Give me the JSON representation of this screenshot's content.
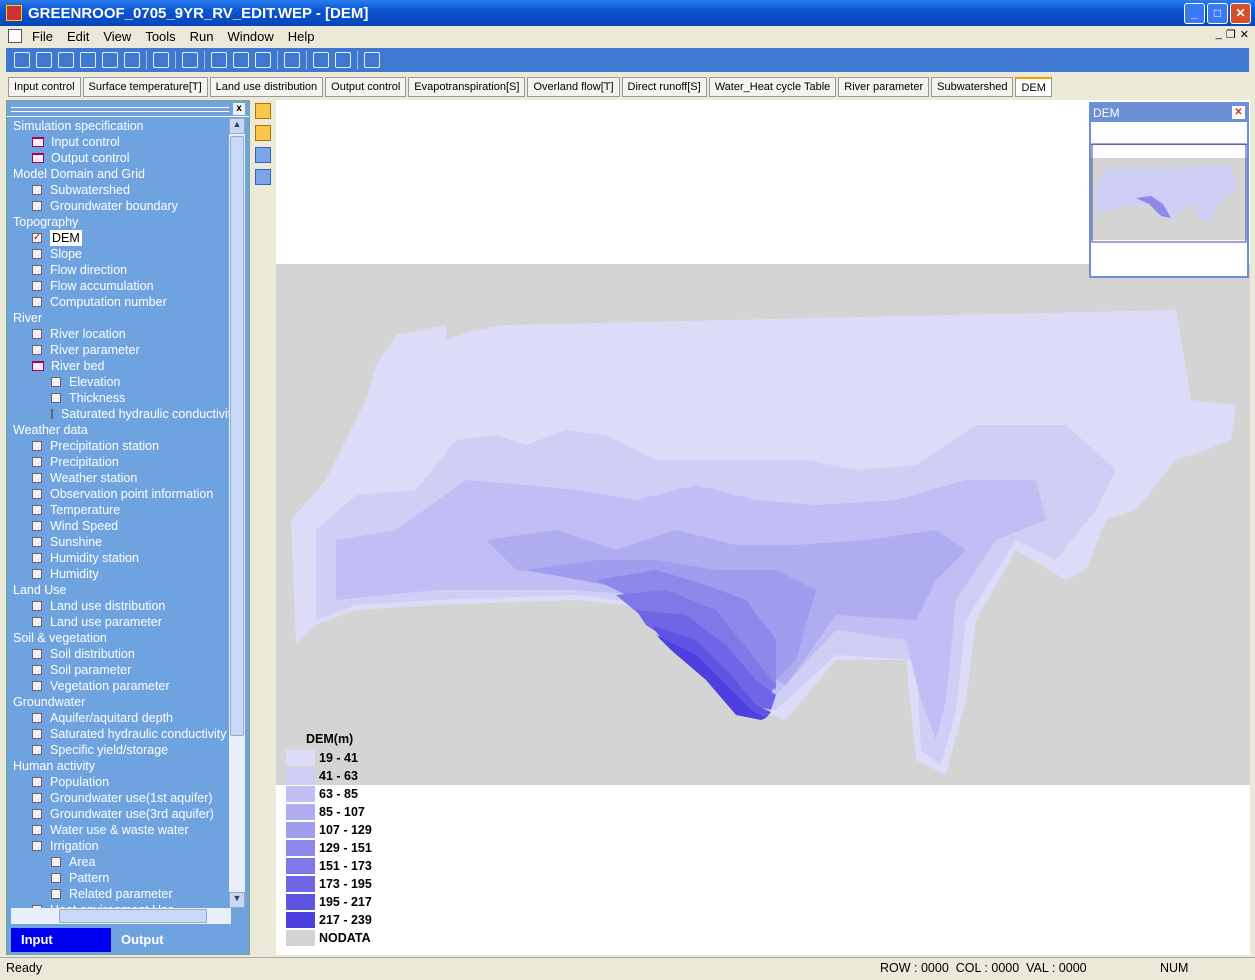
{
  "window": {
    "title": "GREENROOF_0705_9YR_RV_EDIT.WEP - [DEM]"
  },
  "menu": [
    "File",
    "Edit",
    "View",
    "Tools",
    "Run",
    "Window",
    "Help"
  ],
  "tabs": [
    {
      "label": "Input control"
    },
    {
      "label": "Surface temperature[T]"
    },
    {
      "label": "Land use distribution"
    },
    {
      "label": "Output control"
    },
    {
      "label": "Evapotranspiration[S]"
    },
    {
      "label": "Overland flow[T]"
    },
    {
      "label": "Direct runoff[S]"
    },
    {
      "label": "Water_Heat cycle Table"
    },
    {
      "label": "River parameter"
    },
    {
      "label": "Subwatershed"
    },
    {
      "label": "DEM",
      "active": true
    }
  ],
  "tree": [
    {
      "label": "Simulation specification",
      "level": 0,
      "icon": "none"
    },
    {
      "label": "Input control",
      "level": 1,
      "icon": "folder"
    },
    {
      "label": "Output control",
      "level": 1,
      "icon": "folder"
    },
    {
      "label": "Model Domain and Grid",
      "level": 0,
      "icon": "none"
    },
    {
      "label": "Subwatershed",
      "level": 1,
      "icon": "checkbox"
    },
    {
      "label": "Groundwater boundary",
      "level": 1,
      "icon": "checkbox"
    },
    {
      "label": "Topography",
      "level": 0,
      "icon": "none"
    },
    {
      "label": "DEM",
      "level": 1,
      "icon": "checked",
      "selected": true
    },
    {
      "label": "Slope",
      "level": 1,
      "icon": "checkbox"
    },
    {
      "label": "Flow direction",
      "level": 1,
      "icon": "checkbox"
    },
    {
      "label": "Flow accumulation",
      "level": 1,
      "icon": "checkbox"
    },
    {
      "label": "Computation number",
      "level": 1,
      "icon": "checkbox"
    },
    {
      "label": "River",
      "level": 0,
      "icon": "none"
    },
    {
      "label": "River location",
      "level": 1,
      "icon": "checkbox"
    },
    {
      "label": "River parameter",
      "level": 1,
      "icon": "checkbox"
    },
    {
      "label": "River bed",
      "level": 1,
      "icon": "folder"
    },
    {
      "label": "Elevation",
      "level": 2,
      "icon": "checkbox"
    },
    {
      "label": "Thickness",
      "level": 2,
      "icon": "checkbox"
    },
    {
      "label": "Saturated hydraulic conductivity",
      "level": 2,
      "icon": "checkbox"
    },
    {
      "label": "Weather data",
      "level": 0,
      "icon": "none"
    },
    {
      "label": "Precipitation station",
      "level": 1,
      "icon": "checkbox"
    },
    {
      "label": "Precipitation",
      "level": 1,
      "icon": "checkbox"
    },
    {
      "label": "Weather station",
      "level": 1,
      "icon": "checkbox"
    },
    {
      "label": "Observation point information",
      "level": 1,
      "icon": "checkbox"
    },
    {
      "label": "Temperature",
      "level": 1,
      "icon": "checkbox"
    },
    {
      "label": "Wind Speed",
      "level": 1,
      "icon": "checkbox"
    },
    {
      "label": "Sunshine",
      "level": 1,
      "icon": "checkbox"
    },
    {
      "label": "Humidity station",
      "level": 1,
      "icon": "checkbox"
    },
    {
      "label": "Humidity",
      "level": 1,
      "icon": "checkbox"
    },
    {
      "label": "Land Use",
      "level": 0,
      "icon": "none"
    },
    {
      "label": "Land use distribution",
      "level": 1,
      "icon": "checkbox"
    },
    {
      "label": "Land use parameter",
      "level": 1,
      "icon": "checkbox"
    },
    {
      "label": "Soil & vegetation",
      "level": 0,
      "icon": "none"
    },
    {
      "label": "Soil distribution",
      "level": 1,
      "icon": "checkbox"
    },
    {
      "label": "Soil parameter",
      "level": 1,
      "icon": "checkbox"
    },
    {
      "label": "Vegetation parameter",
      "level": 1,
      "icon": "checkbox"
    },
    {
      "label": "Groundwater",
      "level": 0,
      "icon": "none"
    },
    {
      "label": "Aquifer/aquitard depth",
      "level": 1,
      "icon": "checkbox"
    },
    {
      "label": "Saturated hydraulic conductivity",
      "level": 1,
      "icon": "checkbox"
    },
    {
      "label": "Specific yield/storage",
      "level": 1,
      "icon": "checkbox"
    },
    {
      "label": "Human activity",
      "level": 0,
      "icon": "none"
    },
    {
      "label": "Population",
      "level": 1,
      "icon": "checkbox"
    },
    {
      "label": "Groundwater use(1st aquifer)",
      "level": 1,
      "icon": "checkbox"
    },
    {
      "label": "Groundwater use(3rd aquifer)",
      "level": 1,
      "icon": "checkbox"
    },
    {
      "label": "Water use & waste water",
      "level": 1,
      "icon": "checkbox"
    },
    {
      "label": "Irrigation",
      "level": 1,
      "icon": "checkbox"
    },
    {
      "label": "Area",
      "level": 2,
      "icon": "checkbox"
    },
    {
      "label": "Pattern",
      "level": 2,
      "icon": "checkbox"
    },
    {
      "label": "Related parameter",
      "level": 2,
      "icon": "checkbox"
    },
    {
      "label": "Heat environment Use",
      "level": 1,
      "icon": "checkbox"
    }
  ],
  "panel_tabs": {
    "input": "Input",
    "output": "Output"
  },
  "overview": {
    "title": "DEM"
  },
  "legend": {
    "title": "DEM(m)",
    "items": [
      {
        "label": "19 - 41",
        "color": "#dcdcf8"
      },
      {
        "label": "41 - 63",
        "color": "#cfcff6"
      },
      {
        "label": "63 - 85",
        "color": "#c0bef4"
      },
      {
        "label": "85 - 107",
        "color": "#b0acf0"
      },
      {
        "label": "107 - 129",
        "color": "#a09cee"
      },
      {
        "label": "129 - 151",
        "color": "#8e88ea"
      },
      {
        "label": "151 - 173",
        "color": "#7f78e8"
      },
      {
        "label": "173 - 195",
        "color": "#6e66e6"
      },
      {
        "label": "195 - 217",
        "color": "#5e54e2"
      },
      {
        "label": "217 - 239",
        "color": "#4e40e0"
      },
      {
        "label": "NODATA",
        "color": "#d4d4d4"
      }
    ]
  },
  "status": {
    "left": "Ready",
    "coords": "ROW : 0000  COL : 0000  VAL : 0000",
    "num": "NUM"
  }
}
